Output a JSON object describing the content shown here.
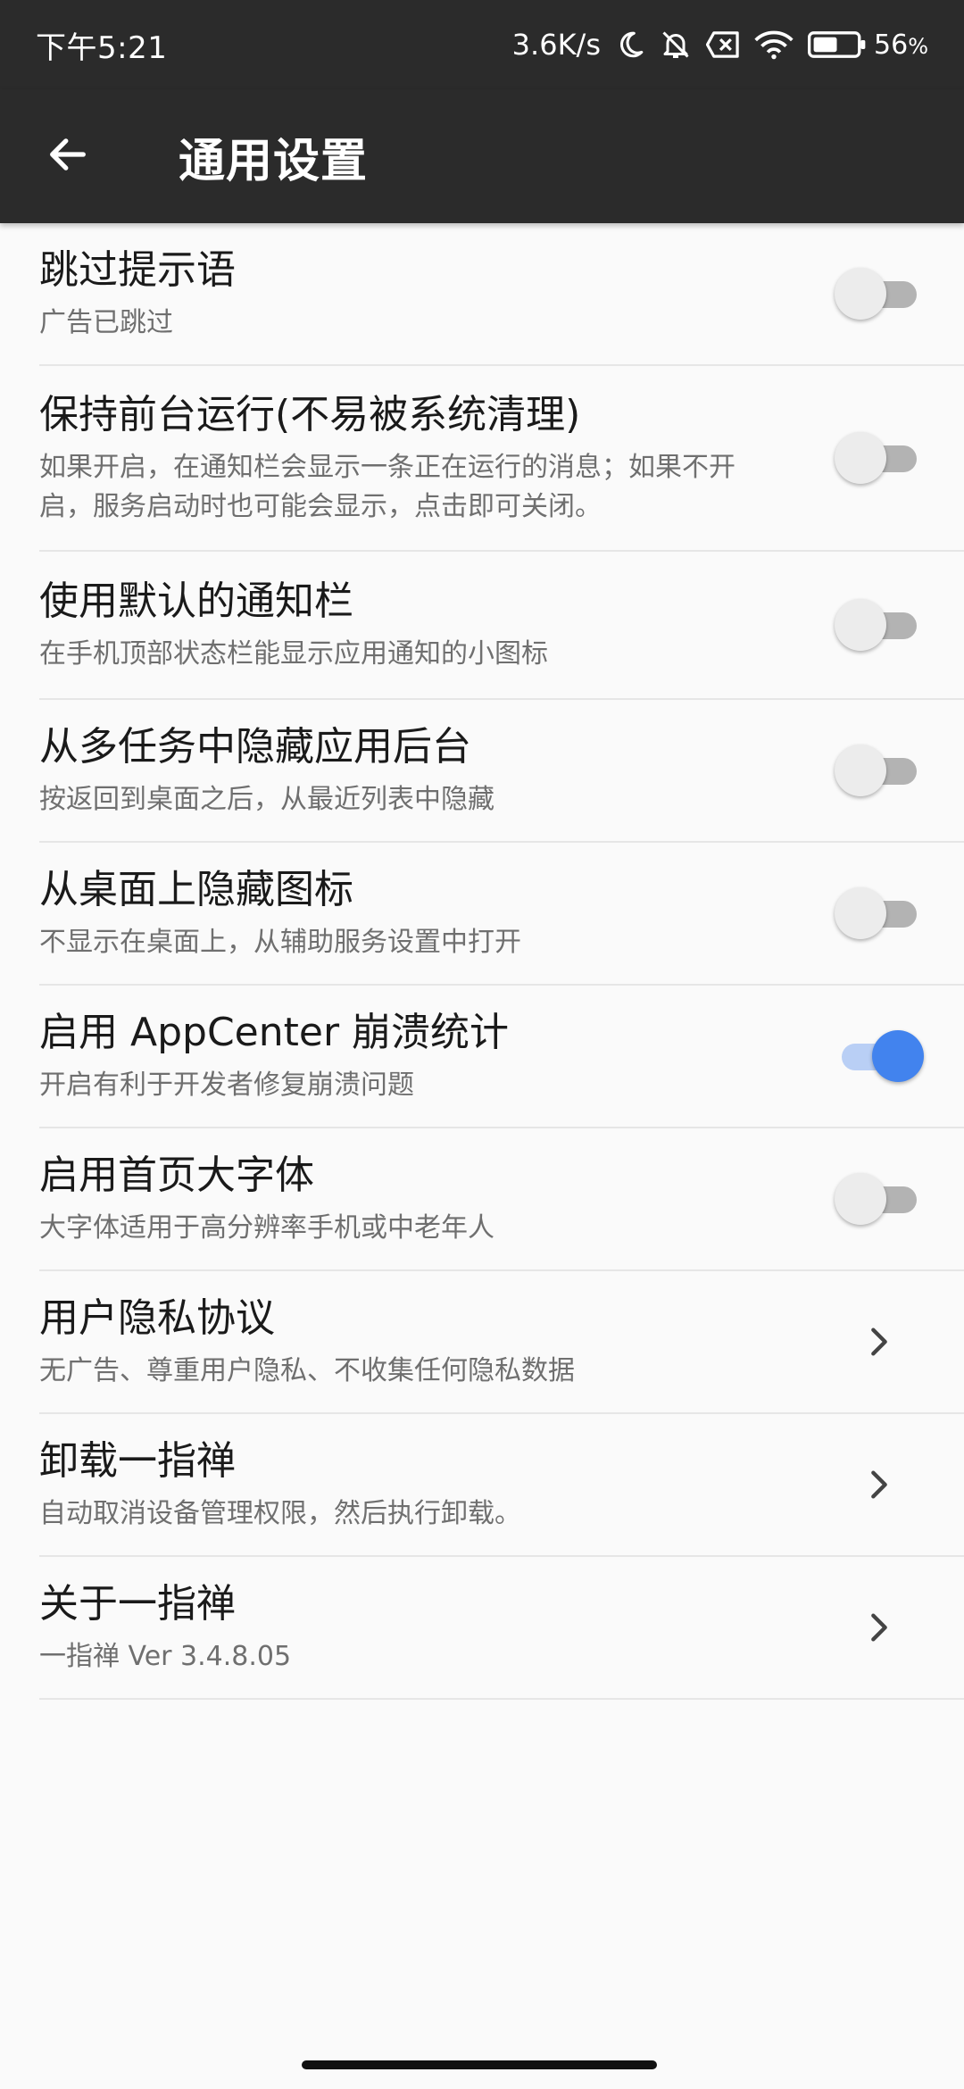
{
  "status_bar": {
    "time": "下午5:21",
    "net_speed": "3.6K/s",
    "battery_percent": "56",
    "battery_unit": "%",
    "battery_level": 0.56,
    "icons": [
      "moon-icon",
      "bell-off-icon",
      "sim-x-icon",
      "wifi-icon",
      "battery-icon"
    ]
  },
  "app_bar": {
    "back_icon": "arrow-left-icon",
    "title": "通用设置",
    "background": "#2b2b2b"
  },
  "colors": {
    "accent": "#4283ee",
    "accent_track": "#b9cff5",
    "toggle_off_track": "#b3b3b3",
    "toggle_off_thumb": "#ececec"
  },
  "settings": [
    {
      "title": "跳过提示语",
      "desc": "广告已跳过",
      "type": "toggle",
      "checked": false
    },
    {
      "title": "保持前台运行(不易被系统清理)",
      "desc": "如果开启，在通知栏会显示一条正在运行的消息；如果不开启，服务启动时也可能会显示，点击即可关闭。",
      "type": "toggle",
      "checked": false
    },
    {
      "title": "使用默认的通知栏",
      "desc": "在手机顶部状态栏能显示应用通知的小图标",
      "type": "toggle",
      "checked": false
    },
    {
      "title": "从多任务中隐藏应用后台",
      "desc": "按返回到桌面之后，从最近列表中隐藏",
      "type": "toggle",
      "checked": false
    },
    {
      "title": "从桌面上隐藏图标",
      "desc": "不显示在桌面上，从辅助服务设置中打开",
      "type": "toggle",
      "checked": false
    },
    {
      "title": "启用 AppCenter 崩溃统计",
      "desc": "开启有利于开发者修复崩溃问题",
      "type": "toggle",
      "checked": true
    },
    {
      "title": "启用首页大字体",
      "desc": "大字体适用于高分辨率手机或中老年人",
      "type": "toggle",
      "checked": false
    },
    {
      "title": "用户隐私协议",
      "desc": "无广告、尊重用户隐私、不收集任何隐私数据",
      "type": "link",
      "icon": "chevron-right-icon"
    },
    {
      "title": "卸载一指禅",
      "desc": "自动取消设备管理权限，然后执行卸载。",
      "type": "link",
      "icon": "chevron-right-icon"
    },
    {
      "title": "关于一指禅",
      "desc": "一指禅 Ver 3.4.8.05",
      "type": "link",
      "icon": "chevron-right-icon"
    }
  ]
}
